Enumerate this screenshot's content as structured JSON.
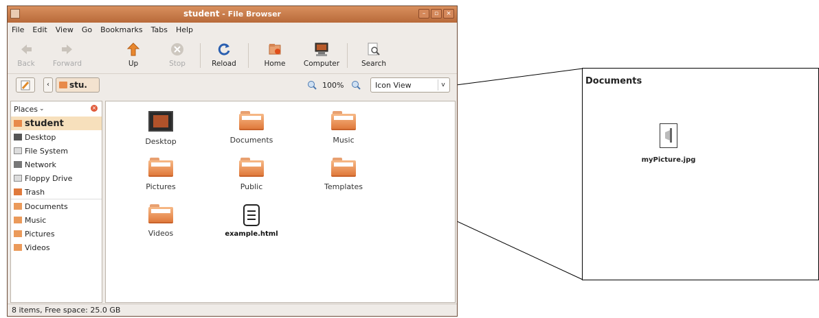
{
  "window": {
    "title": "student",
    "app": " - File Browser",
    "controls": [
      "–",
      "▫",
      "×"
    ]
  },
  "menu": [
    "File",
    "Edit",
    "View",
    "Go",
    "Bookmarks",
    "Tabs",
    "Help"
  ],
  "toolbar": {
    "back": "Back",
    "forward": "Forward",
    "up": "Up",
    "stop": "Stop",
    "reload": "Reload",
    "home": "Home",
    "computer": "Computer",
    "search": "Search"
  },
  "location": {
    "path": "stu.",
    "zoom": "100%",
    "view": "Icon View"
  },
  "sidebar": {
    "header": "Places",
    "items": [
      {
        "label": "student",
        "icon": "home-folder-icon"
      },
      {
        "label": "Desktop",
        "icon": "desktop-icon"
      },
      {
        "label": "File System",
        "icon": "drive-icon"
      },
      {
        "label": "Network",
        "icon": "network-icon"
      },
      {
        "label": "Floppy Drive",
        "icon": "floppy-icon"
      },
      {
        "label": "Trash",
        "icon": "trash-icon"
      },
      {
        "label": "Documents",
        "icon": "folder-icon"
      },
      {
        "label": "Music",
        "icon": "folder-icon"
      },
      {
        "label": "Pictures",
        "icon": "folder-icon"
      },
      {
        "label": "Videos",
        "icon": "folder-icon"
      }
    ]
  },
  "files": [
    {
      "label": "Desktop",
      "icon": "desktop-folder-icon"
    },
    {
      "label": "Documents",
      "icon": "folder-icon"
    },
    {
      "label": "Music",
      "icon": "folder-icon"
    },
    {
      "label": "Pictures",
      "icon": "folder-icon"
    },
    {
      "label": "Public",
      "icon": "folder-icon"
    },
    {
      "label": "Templates",
      "icon": "folder-icon"
    },
    {
      "label": "Videos",
      "icon": "folder-icon"
    },
    {
      "label": "example.html",
      "icon": "html-file-icon"
    }
  ],
  "status": "8 items, Free space: 25.0 GB",
  "callout": {
    "title": "Documents",
    "file": "myPicture.jpg"
  }
}
